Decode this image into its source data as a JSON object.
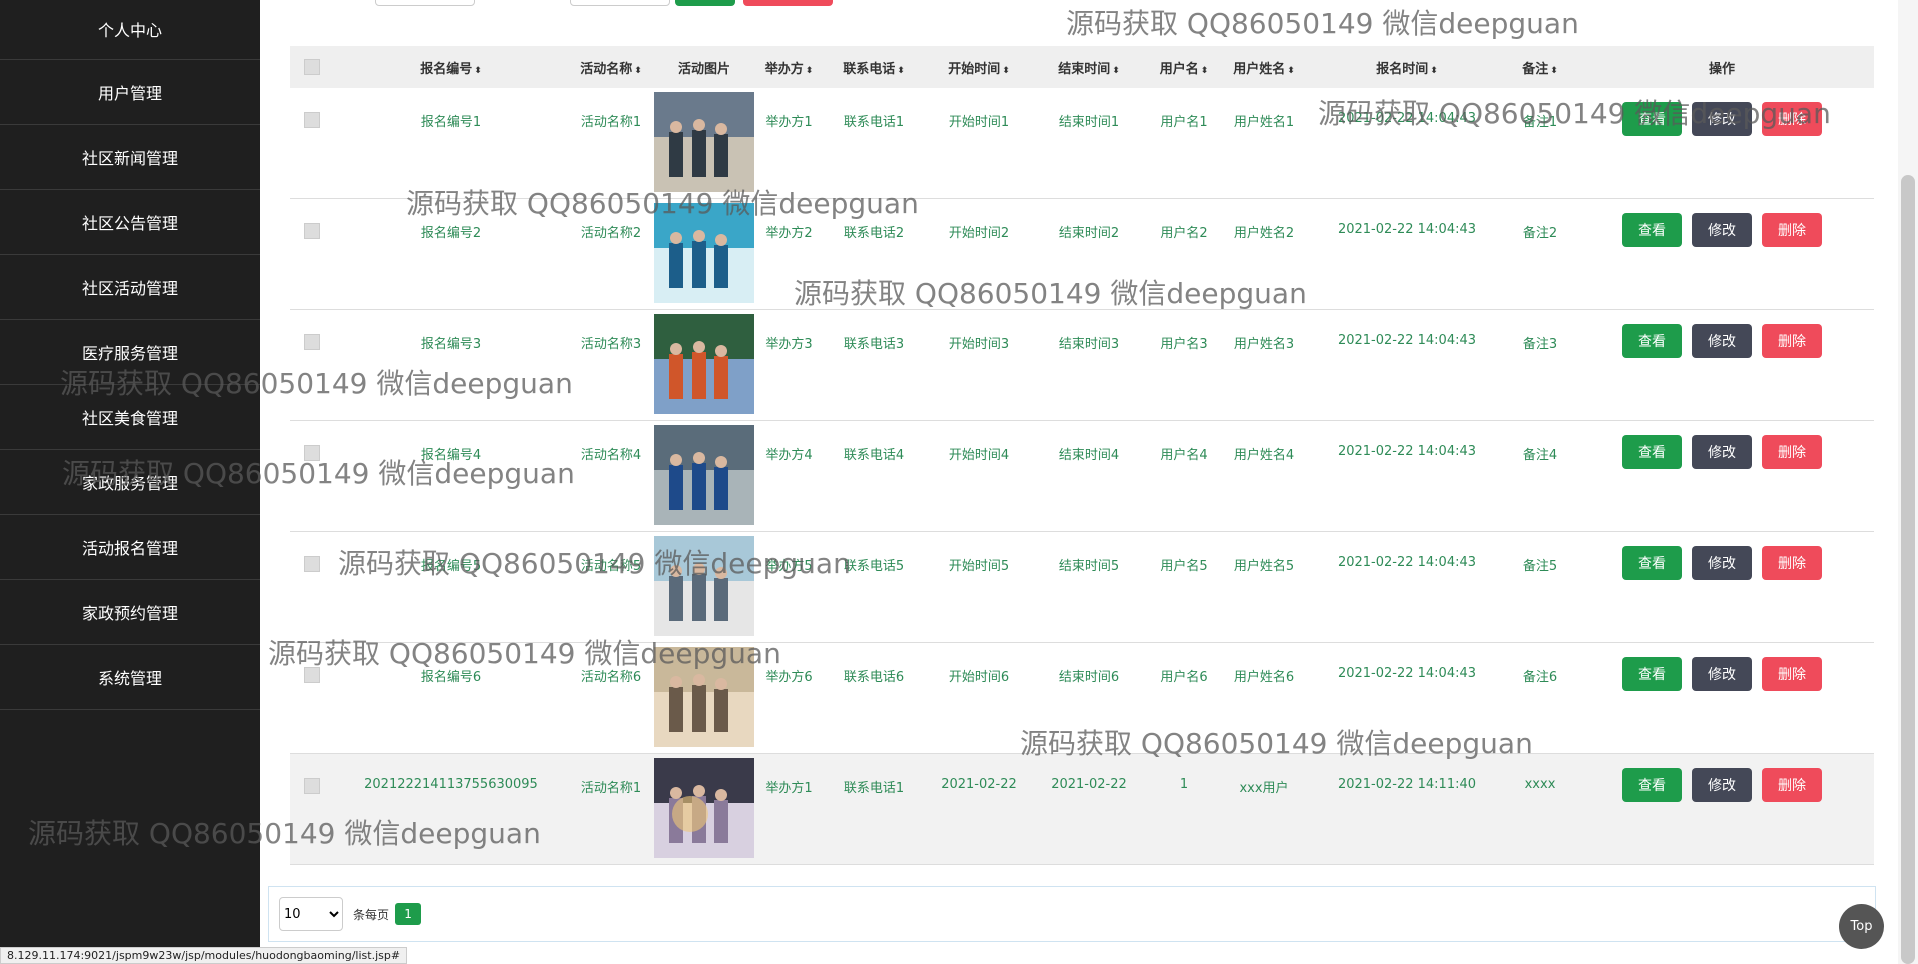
{
  "sidebar": {
    "items": [
      {
        "label": "个人中心"
      },
      {
        "label": "用户管理"
      },
      {
        "label": "社区新闻管理"
      },
      {
        "label": "社区公告管理"
      },
      {
        "label": "社区活动管理"
      },
      {
        "label": "医疗服务管理"
      },
      {
        "label": "社区美食管理"
      },
      {
        "label": "家政服务管理"
      },
      {
        "label": "活动报名管理"
      },
      {
        "label": "家政预约管理"
      },
      {
        "label": "系统管理"
      }
    ]
  },
  "table": {
    "headers": [
      "报名编号",
      "活动名称",
      "活动图片",
      "举办方",
      "联系电话",
      "开始时间",
      "结束时间",
      "用户名",
      "用户姓名",
      "报名时间",
      "备注",
      "操作"
    ],
    "rows": [
      {
        "id": "报名编号1",
        "name": "活动名称1",
        "org": "举办方1",
        "phone": "联系电话1",
        "start": "开始时间1",
        "end": "结束时间1",
        "user": "用户名1",
        "uname": "用户姓名1",
        "time": "2021-02-22 14:04:43",
        "note": "备注1"
      },
      {
        "id": "报名编号2",
        "name": "活动名称2",
        "org": "举办方2",
        "phone": "联系电话2",
        "start": "开始时间2",
        "end": "结束时间2",
        "user": "用户名2",
        "uname": "用户姓名2",
        "time": "2021-02-22 14:04:43",
        "note": "备注2"
      },
      {
        "id": "报名编号3",
        "name": "活动名称3",
        "org": "举办方3",
        "phone": "联系电话3",
        "start": "开始时间3",
        "end": "结束时间3",
        "user": "用户名3",
        "uname": "用户姓名3",
        "time": "2021-02-22 14:04:43",
        "note": "备注3"
      },
      {
        "id": "报名编号4",
        "name": "活动名称4",
        "org": "举办方4",
        "phone": "联系电话4",
        "start": "开始时间4",
        "end": "结束时间4",
        "user": "用户名4",
        "uname": "用户姓名4",
        "time": "2021-02-22 14:04:43",
        "note": "备注4"
      },
      {
        "id": "报名编号5",
        "name": "活动名称5",
        "org": "举办方5",
        "phone": "联系电话5",
        "start": "开始时间5",
        "end": "结束时间5",
        "user": "用户名5",
        "uname": "用户姓名5",
        "time": "2021-02-22 14:04:43",
        "note": "备注5"
      },
      {
        "id": "报名编号6",
        "name": "活动名称6",
        "org": "举办方6",
        "phone": "联系电话6",
        "start": "开始时间6",
        "end": "结束时间6",
        "user": "用户名6",
        "uname": "用户姓名6",
        "time": "2021-02-22 14:04:43",
        "note": "备注6"
      },
      {
        "id": "20212221411375563009​5",
        "name": "活动名称1",
        "org": "举办方1",
        "phone": "联系电话1",
        "start": "2021-02-22",
        "end": "2021-02-22",
        "user": "1",
        "uname": "xxx用户",
        "time": "2021-02-22 14:11:40",
        "note": "xxxx"
      }
    ],
    "actions": {
      "view": "查看",
      "edit": "修改",
      "delete": "删除"
    }
  },
  "pager": {
    "page_size": "10",
    "per_page_label": "条每页",
    "current_page": "1"
  },
  "top_button": "Top",
  "status_url": "8.129.11.174:9021/jspm9w23w/jsp/modules/huodongbaoming/list.jsp#",
  "watermark": "源码获取 QQ86050149 微信deepguan",
  "colors": {
    "sidebar_bg": "#1f1f1f",
    "accent_green": "#1e9c4b",
    "edit_gray": "#444857",
    "delete_red": "#ef4b5b",
    "cell_text": "#2e8b57"
  }
}
